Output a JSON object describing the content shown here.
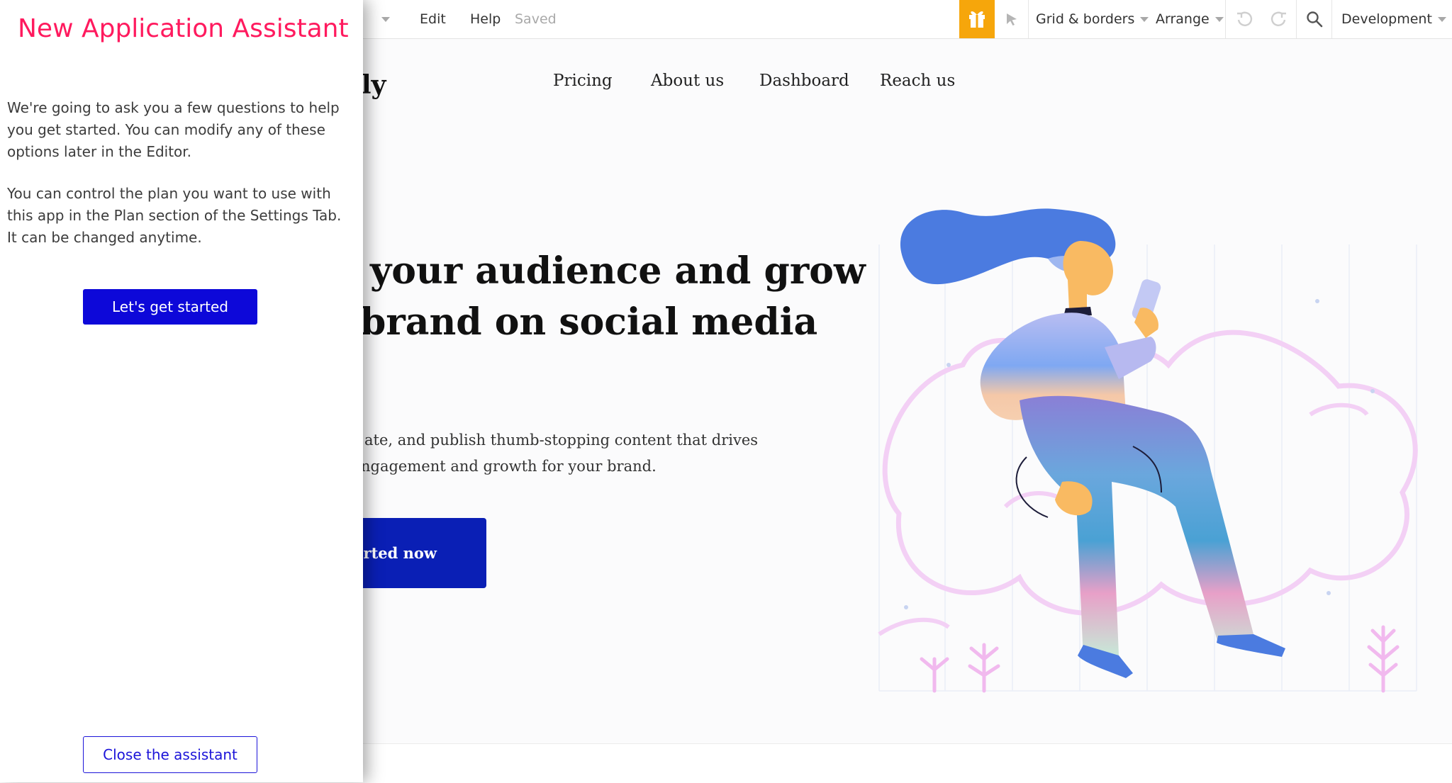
{
  "toolbar": {
    "edit_label": "Edit",
    "help_label": "Help",
    "saved_status": "Saved",
    "grid_label": "Grid & borders",
    "arrange_label": "Arrange",
    "environment_label": "Development",
    "gift_color": "#f6a60b"
  },
  "site": {
    "logo_text": "erly",
    "nav": [
      "Pricing",
      "About us",
      "Dashboard",
      "Reach us"
    ],
    "hero_title_line1": "your audience and grow",
    "hero_title_line2": "brand on social media",
    "hero_body_line1": "ate, and publish thumb-stopping content that drives",
    "hero_body_line2": "ngagement and growth for your brand.",
    "cta_label": "arted now",
    "cta_color": "#0a1fb5"
  },
  "assistant": {
    "title": "New Application Assistant",
    "paragraph1": "We're going to ask you a few questions to help you get started. You can modify any of these options later in the Editor.",
    "paragraph2": "You can control the plan you want to use with this app in the Plan section of the Settings Tab. It can be changed anytime.",
    "start_button": "Let's get started",
    "close_button": "Close the assistant",
    "title_color": "#ff1a5e",
    "button_color": "#0d08d9"
  },
  "icons": [
    "gift-icon",
    "pointer-icon",
    "undo-icon",
    "redo-icon",
    "search-icon",
    "chevron-down-icon"
  ]
}
